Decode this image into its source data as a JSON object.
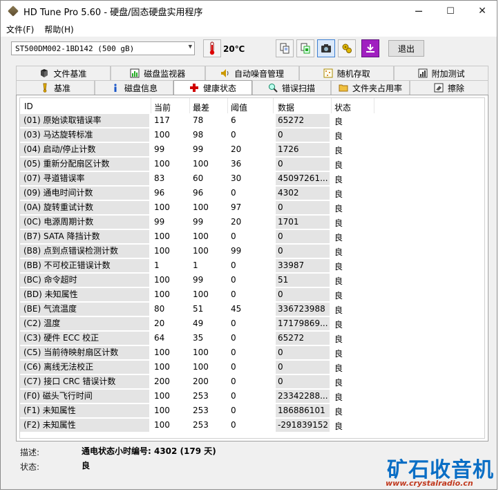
{
  "window": {
    "title": "HD Tune Pro 5.60 - 硬盘/固态硬盘实用程序",
    "minimize": "─",
    "maximize": "☐",
    "close": "✕"
  },
  "menu": {
    "file": "文件(F)",
    "help": "帮助(H)"
  },
  "toolbar": {
    "drive": "ST500DM002-1BD142 (500 gB)",
    "temperature": "20℃",
    "exit_label": "退出",
    "icons": [
      "copy-text-icon",
      "copy-info-icon",
      "screenshot-icon",
      "settings-icon",
      "save-icon"
    ]
  },
  "tabs_top": [
    {
      "label": "文件基准",
      "icon": "file-benchmark-icon"
    },
    {
      "label": "磁盘监视器",
      "icon": "disk-monitor-icon"
    },
    {
      "label": "自动噪音管理",
      "icon": "speaker-icon"
    },
    {
      "label": "随机存取",
      "icon": "random-access-icon"
    },
    {
      "label": "附加测试",
      "icon": "extra-tests-icon"
    }
  ],
  "tabs_bottom": [
    {
      "label": "基准",
      "icon": "benchmark-icon",
      "active": false
    },
    {
      "label": "磁盘信息",
      "icon": "info-icon",
      "active": false
    },
    {
      "label": "健康状态",
      "icon": "health-cross-icon",
      "active": true
    },
    {
      "label": "错误扫描",
      "icon": "magnifier-icon",
      "active": false
    },
    {
      "label": "文件夹占用率",
      "icon": "folder-icon",
      "active": false
    },
    {
      "label": "擦除",
      "icon": "erase-icon",
      "active": false
    }
  ],
  "table": {
    "headers": {
      "id": "ID",
      "current": "当前",
      "worst": "最差",
      "threshold": "阈值",
      "data": "数据",
      "status": "状态"
    },
    "rows": [
      {
        "id": "(01) 原始读取错误率",
        "current": "117",
        "worst": "78",
        "threshold": "6",
        "data": "65272",
        "status": "良"
      },
      {
        "id": "(03) 马达旋转标准",
        "current": "100",
        "worst": "98",
        "threshold": "0",
        "data": "0",
        "status": "良"
      },
      {
        "id": "(04) 启动/停止计数",
        "current": "99",
        "worst": "99",
        "threshold": "20",
        "data": "1726",
        "status": "良"
      },
      {
        "id": "(05) 重新分配扇区计数",
        "current": "100",
        "worst": "100",
        "threshold": "36",
        "data": "0",
        "status": "良"
      },
      {
        "id": "(07) 寻道错误率",
        "current": "83",
        "worst": "60",
        "threshold": "30",
        "data": "45097261...",
        "status": "良"
      },
      {
        "id": "(09) 通电时间计数",
        "current": "96",
        "worst": "96",
        "threshold": "0",
        "data": "4302",
        "status": "良"
      },
      {
        "id": "(0A) 旋转重试计数",
        "current": "100",
        "worst": "100",
        "threshold": "97",
        "data": "0",
        "status": "良"
      },
      {
        "id": "(0C) 电源周期计数",
        "current": "99",
        "worst": "99",
        "threshold": "20",
        "data": "1701",
        "status": "良"
      },
      {
        "id": "(B7) SATA 降挡计数",
        "current": "100",
        "worst": "100",
        "threshold": "0",
        "data": "0",
        "status": "良"
      },
      {
        "id": "(B8) 点到点错误检测计数",
        "current": "100",
        "worst": "100",
        "threshold": "99",
        "data": "0",
        "status": "良"
      },
      {
        "id": "(BB) 不可校正错误计数",
        "current": "1",
        "worst": "1",
        "threshold": "0",
        "data": "33987",
        "status": "良"
      },
      {
        "id": "(BC) 命令超时",
        "current": "100",
        "worst": "99",
        "threshold": "0",
        "data": "51",
        "status": "良"
      },
      {
        "id": "(BD) 未知属性",
        "current": "100",
        "worst": "100",
        "threshold": "0",
        "data": "0",
        "status": "良"
      },
      {
        "id": "(BE) 气流温度",
        "current": "80",
        "worst": "51",
        "threshold": "45",
        "data": "336723988",
        "status": "良"
      },
      {
        "id": "(C2) 温度",
        "current": "20",
        "worst": "49",
        "threshold": "0",
        "data": "17179869...",
        "status": "良"
      },
      {
        "id": "(C3) 硬件 ECC 校正",
        "current": "64",
        "worst": "35",
        "threshold": "0",
        "data": "65272",
        "status": "良"
      },
      {
        "id": "(C5) 当前待映射扇区计数",
        "current": "100",
        "worst": "100",
        "threshold": "0",
        "data": "0",
        "status": "良"
      },
      {
        "id": "(C6) 离线无法校正",
        "current": "100",
        "worst": "100",
        "threshold": "0",
        "data": "0",
        "status": "良"
      },
      {
        "id": "(C7) 接口 CRC 错误计数",
        "current": "200",
        "worst": "200",
        "threshold": "0",
        "data": "0",
        "status": "良"
      },
      {
        "id": "(F0) 磁头飞行时间",
        "current": "100",
        "worst": "253",
        "threshold": "0",
        "data": "23342288...",
        "status": "良"
      },
      {
        "id": "(F1) 未知属性",
        "current": "100",
        "worst": "253",
        "threshold": "0",
        "data": "186886101",
        "status": "良"
      },
      {
        "id": "(F2) 未知属性",
        "current": "100",
        "worst": "253",
        "threshold": "0",
        "data": "-291839152",
        "status": "良"
      }
    ]
  },
  "details": {
    "desc_label": "描述:",
    "desc_value": "通电状态小时编号: 4302 (179 天)",
    "status_label": "状态:",
    "status_value": "良"
  },
  "watermark": {
    "text": "矿石收音机",
    "url": "www.crystalradio.cn"
  }
}
